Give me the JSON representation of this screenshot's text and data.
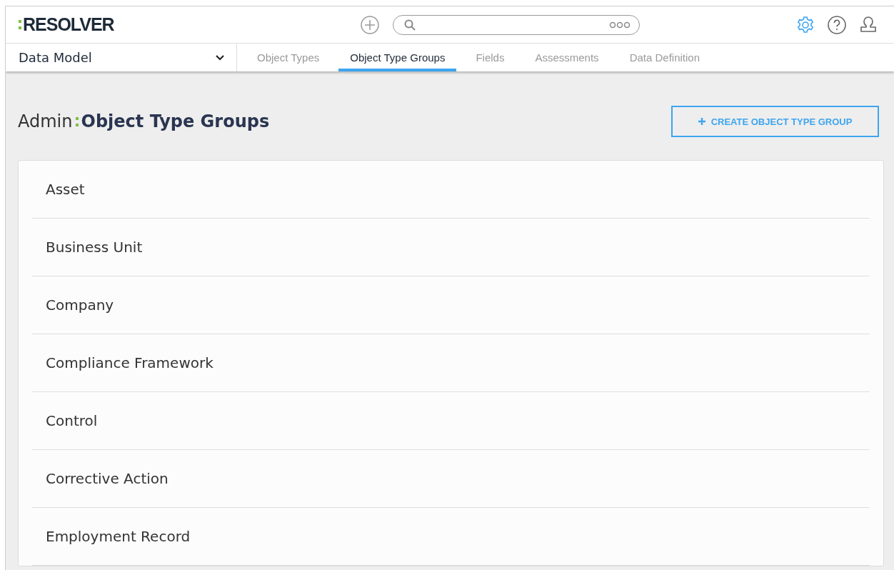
{
  "header": {
    "logo": "RESOLVER"
  },
  "nav": {
    "section": "Data Model",
    "tabs": [
      {
        "label": "Object Types",
        "selected": false
      },
      {
        "label": "Object Type Groups",
        "selected": true
      },
      {
        "label": "Fields",
        "selected": false
      },
      {
        "label": "Assessments",
        "selected": false
      },
      {
        "label": "Data Definition",
        "selected": false
      }
    ]
  },
  "page": {
    "breadcrumb": "Admin",
    "title": "Object Type Groups",
    "create_button": "CREATE OBJECT TYPE GROUP"
  },
  "groups": [
    "Asset",
    "Business Unit",
    "Company",
    "Compliance Framework",
    "Control",
    "Corrective Action",
    "Employment Record"
  ]
}
